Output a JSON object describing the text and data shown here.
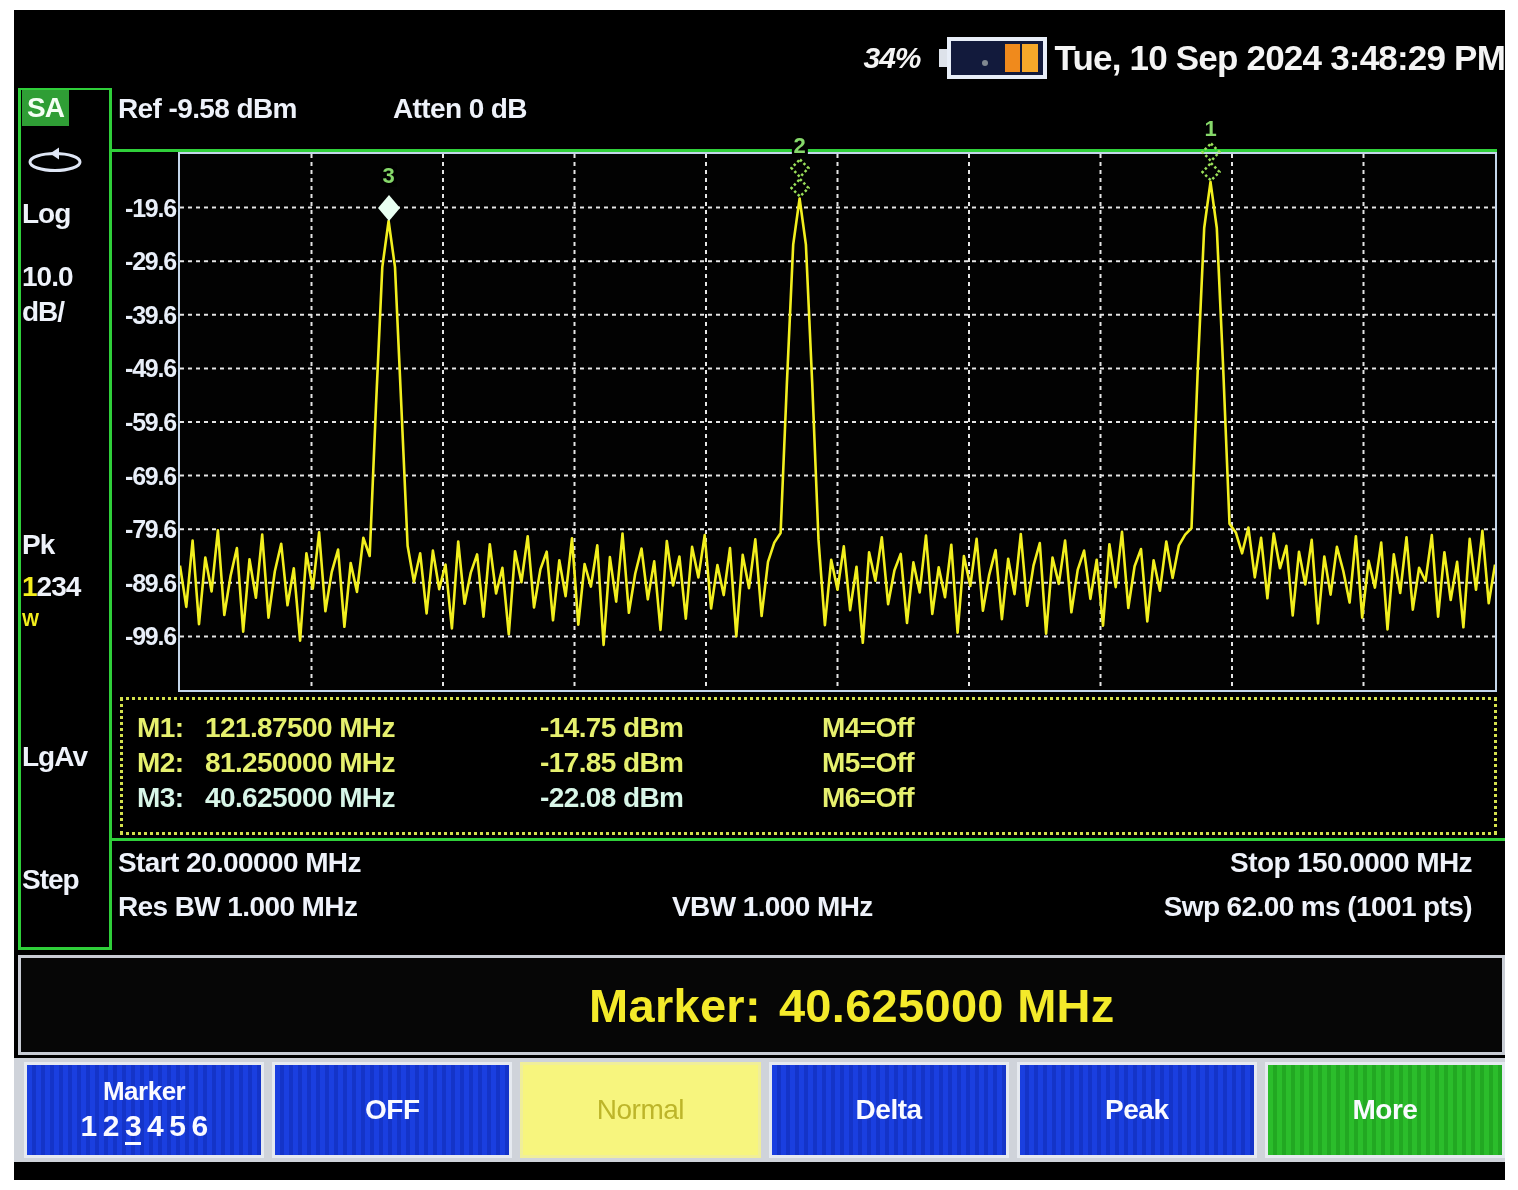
{
  "status_bar": {
    "battery": "34%",
    "datetime": "Tue, 10 Sep 2024 3:48:29 PM"
  },
  "sidebar": {
    "mode_badge": "SA",
    "scale_type": "Log",
    "scale_value": "10.0",
    "scale_unit": "dB/",
    "detector": "Pk",
    "traces": [
      {
        "label": "1",
        "active": true
      },
      {
        "label": "2",
        "active": false
      },
      {
        "label": "3",
        "active": false
      },
      {
        "label": "4",
        "active": false
      }
    ],
    "trace_mode": "W",
    "average_type": "LgAv",
    "step_label": "Step"
  },
  "header": {
    "reference_level": "Ref -9.58 dBm",
    "attenuation": "Atten 0 dB"
  },
  "graph": {
    "chart_data": {
      "type": "line",
      "grid": true,
      "ylim": [
        -109.6,
        -9.6
      ],
      "yticks": [
        -19.6,
        -29.6,
        -39.6,
        -49.6,
        -59.6,
        -69.6,
        -79.6,
        -89.6,
        -99.6
      ],
      "categories": [
        null,
        null,
        null,
        null,
        null,
        null,
        null,
        null,
        null,
        null,
        null,
        null,
        null,
        null,
        null,
        null,
        null,
        null,
        null,
        null,
        null,
        null,
        null,
        null,
        null,
        null,
        null,
        null,
        null,
        null,
        null,
        null,
        null,
        null,
        null,
        null,
        null,
        null,
        null,
        null,
        null,
        null,
        null,
        null,
        null,
        null,
        null,
        null,
        null,
        null,
        null,
        null,
        null,
        null,
        null,
        null,
        null,
        null,
        null,
        null,
        null,
        null,
        null,
        null,
        null,
        null,
        null,
        null,
        null,
        null,
        null,
        null,
        null,
        null,
        null,
        null,
        null,
        null,
        null,
        null,
        null,
        null,
        null,
        null,
        null,
        null,
        null,
        null,
        null,
        null,
        null,
        null,
        null,
        null,
        null,
        null,
        null,
        null,
        null,
        null,
        null,
        null,
        null,
        null,
        null,
        null,
        null,
        null,
        null,
        null,
        null,
        null,
        null,
        null,
        null,
        null,
        null,
        null,
        null,
        null,
        null,
        null,
        null,
        null,
        null,
        null,
        null,
        null,
        null,
        null,
        null,
        null,
        null,
        null,
        null,
        null,
        null,
        null,
        null,
        null,
        null,
        null,
        null,
        null,
        null,
        null,
        null,
        null,
        null,
        null,
        null,
        null,
        null,
        null,
        null,
        null,
        null,
        null,
        null,
        null,
        null,
        null,
        null,
        null,
        null,
        null,
        null,
        null,
        null,
        null,
        null,
        null,
        null,
        null,
        null,
        null,
        null,
        null,
        null,
        null,
        null,
        null,
        null,
        null,
        null,
        null,
        null,
        null,
        null,
        null,
        null,
        null,
        null,
        null,
        null,
        null,
        null,
        null,
        null,
        null,
        null,
        null,
        null,
        null,
        null,
        null,
        null,
        null,
        null
      ],
      "series": [
        {
          "color": "#f2ef1e",
          "values": [
            -86.4,
            -94.1,
            -81.7,
            -97.3,
            -84.9,
            -91.2,
            -79.8,
            -95.6,
            -88.3,
            -83.1,
            -98.7,
            -85.2,
            -92.4,
            -80.6,
            -96.1,
            -87.5,
            -82.3,
            -93.8,
            -86.9,
            -100.4,
            -84.1,
            -90.7,
            -80.2,
            -94.9,
            -87.6,
            -83.4,
            -97.8,
            -85.9,
            -91.3,
            -81.2,
            -84.6,
            -56.5,
            -30.7,
            -22.1,
            -30.7,
            -56.5,
            -82.7,
            -89.4,
            -84.1,
            -95.3,
            -83.6,
            -90.8,
            -86.2,
            -98.1,
            -81.9,
            -93.5,
            -87.7,
            -84.3,
            -95.9,
            -82.4,
            -91.6,
            -86.8,
            -99.2,
            -83.7,
            -89.5,
            -80.9,
            -94.2,
            -87.1,
            -83.8,
            -96.6,
            -85.4,
            -92.1,
            -81.3,
            -97.4,
            -86.1,
            -90.3,
            -82.6,
            -101.2,
            -84.8,
            -93.1,
            -80.4,
            -95.2,
            -87.9,
            -83.2,
            -92.7,
            -85.6,
            -98.4,
            -81.8,
            -90.1,
            -84.7,
            -96.3,
            -82.9,
            -88.6,
            -80.7,
            -94.4,
            -86.3,
            -91.9,
            -83.1,
            -99.6,
            -84.4,
            -90.6,
            -81.5,
            -95.8,
            -85.7,
            -82.1,
            -80.3,
            -52.3,
            -26.5,
            -17.9,
            -26.5,
            -52.3,
            -81.6,
            -97.5,
            -85.3,
            -90.9,
            -82.8,
            -94.7,
            -86.6,
            -100.8,
            -83.9,
            -89.2,
            -81.1,
            -93.6,
            -87.3,
            -84.2,
            -97.1,
            -85.8,
            -91.4,
            -80.8,
            -95.4,
            -86.7,
            -92.3,
            -82.5,
            -98.9,
            -84.6,
            -90.2,
            -81.4,
            -94.8,
            -88.1,
            -83.5,
            -96.4,
            -85.1,
            -91.7,
            -80.5,
            -93.9,
            -86.4,
            -82.2,
            -99.1,
            -84.9,
            -89.8,
            -81.7,
            -95.1,
            -87.2,
            -83.6,
            -92.6,
            -85.3,
            -97.6,
            -82.4,
            -90.4,
            -80.1,
            -94.3,
            -86.5,
            -83.3,
            -96.8,
            -85.4,
            -91.1,
            -81.9,
            -88.7,
            -82.6,
            -80.6,
            -79.4,
            -49.2,
            -23.4,
            -14.8,
            -23.4,
            -49.2,
            -78.6,
            -80.2,
            -84.1,
            -79.3,
            -88.6,
            -81.2,
            -92.5,
            -80.4,
            -86.9,
            -82.7,
            -95.7,
            -83.8,
            -89.9,
            -81.6,
            -97.2,
            -84.7,
            -91.8,
            -82.9,
            -87.4,
            -93.3,
            -80.9,
            -96.1,
            -85.5,
            -90.5,
            -82.1,
            -98.3,
            -84.3,
            -91.5,
            -81.1,
            -94.6,
            -86.8,
            -89.3,
            -80.7,
            -95.9,
            -83.9,
            -92.8,
            -85.7,
            -97.9,
            -81.4,
            -90.9,
            -79.9,
            -93.4,
            -86.2
          ]
        }
      ]
    },
    "markers": [
      {
        "label": "3",
        "selected": true
      },
      {
        "label": "2",
        "selected": false
      },
      {
        "label": "1",
        "selected": false
      }
    ]
  },
  "marker_table": {
    "rows": [
      {
        "label": "M1:",
        "frequency": "121.87500 MHz",
        "amplitude": "-14.75 dBm",
        "selected": false
      },
      {
        "label": "M2:",
        "frequency": "81.250000 MHz",
        "amplitude": "-17.85 dBm",
        "selected": false
      },
      {
        "label": "M3:",
        "frequency": "40.625000 MHz",
        "amplitude": "-22.08 dBm",
        "selected": true
      }
    ],
    "off_markers": [
      "M4=Off",
      "M5=Off",
      "M6=Off"
    ]
  },
  "sweep_info": {
    "start": "Start 20.00000 MHz",
    "stop": "Stop 150.0000 MHz",
    "res_bw": "Res BW 1.000 MHz",
    "vbw": "VBW 1.000 MHz",
    "sweep": "Swp 62.00 ms (1001 pts)"
  },
  "active_function": {
    "label": "Marker:",
    "value": "40.625000 MHz"
  },
  "softkeys": [
    {
      "kind": "marker_select",
      "label": "Marker",
      "numbers": [
        {
          "label": "1",
          "selected": false
        },
        {
          "label": "2",
          "selected": false
        },
        {
          "label": "3",
          "selected": true
        },
        {
          "label": "4",
          "selected": false
        },
        {
          "label": "5",
          "selected": false
        },
        {
          "label": "6",
          "selected": false
        }
      ]
    },
    {
      "kind": "option",
      "label": "OFF",
      "selected": false
    },
    {
      "kind": "option",
      "label": "Normal",
      "selected": true
    },
    {
      "kind": "option",
      "label": "Delta",
      "selected": false
    },
    {
      "kind": "option",
      "label": "Peak",
      "selected": false
    },
    {
      "kind": "more",
      "label": "More"
    }
  ]
}
